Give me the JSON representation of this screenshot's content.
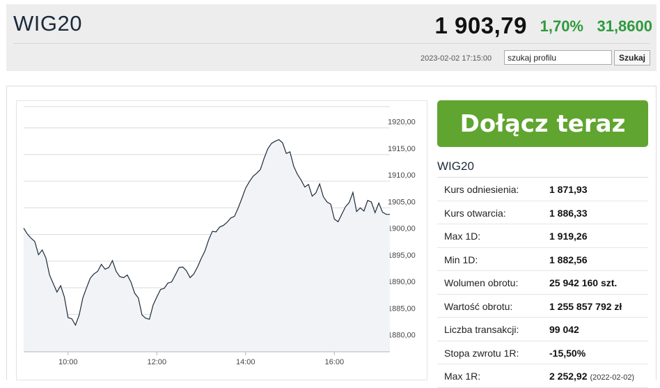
{
  "header": {
    "title": "WIG20",
    "price": "1 903,79",
    "change_pct": "1,70%",
    "change_abs": "31,8600",
    "timestamp": "2023-02-02 17:15:00",
    "search_value": "szukaj profilu",
    "search_button": "Szukaj"
  },
  "colors": {
    "accent_green": "#2e9a3e",
    "cta_green": "#5fa52f",
    "line": "#1b2a3a",
    "fill": "#f1f3f6"
  },
  "cta": {
    "label": "Dołącz teraz"
  },
  "sidebar": {
    "title": "WIG20",
    "rows": [
      {
        "label": "Kurs odniesienia:",
        "value": "1 871,93"
      },
      {
        "label": "Kurs otwarcia:",
        "value": "1 886,33"
      },
      {
        "label": "Max 1D:",
        "value": "1 919,26"
      },
      {
        "label": "Min 1D:",
        "value": "1 882,56"
      },
      {
        "label": "Wolumen obrotu:",
        "value": "25 942 160 szt."
      },
      {
        "label": "Wartość obrotu:",
        "value": "1 255 857 792 zł"
      },
      {
        "label": "Liczba transakcji:",
        "value": "99 042"
      },
      {
        "label": "Stopa zwrotu 1R:",
        "value": "-15,50%"
      },
      {
        "label": "Max 1R:",
        "value": "2 252,92",
        "note": "(2022-02-02)"
      }
    ]
  },
  "chart_data": {
    "type": "area",
    "y_ticks": [
      "1880,00",
      "1885,00",
      "1890,00",
      "1895,00",
      "1900,00",
      "1905,00",
      "1910,00",
      "1915,00",
      "1920,00"
    ],
    "x_ticks": [
      "10:00",
      "12:00",
      "14:00",
      "16:00"
    ],
    "ylim": [
      1878,
      1924
    ],
    "xlim": [
      "09:00",
      "17:15"
    ],
    "grid": true,
    "series": [
      {
        "x": [
          "09:00",
          "09:05",
          "09:10",
          "09:15",
          "09:20",
          "09:25",
          "09:30",
          "09:35",
          "09:40",
          "09:45",
          "09:50",
          "09:55",
          "10:00",
          "10:05",
          "10:10",
          "10:15",
          "10:20",
          "10:25",
          "10:30",
          "10:35",
          "10:40",
          "10:45",
          "10:50",
          "10:55",
          "11:00",
          "11:05",
          "11:10",
          "11:15",
          "11:20",
          "11:25",
          "11:30",
          "11:35",
          "11:40",
          "11:45",
          "11:50",
          "11:55",
          "12:00",
          "12:05",
          "12:10",
          "12:15",
          "12:20",
          "12:25",
          "12:30",
          "12:35",
          "12:40",
          "12:45",
          "12:50",
          "12:55",
          "13:00",
          "13:05",
          "13:10",
          "13:15",
          "13:20",
          "13:25",
          "13:30",
          "13:35",
          "13:40",
          "13:45",
          "13:50",
          "13:55",
          "14:00",
          "14:05",
          "14:10",
          "14:15",
          "14:20",
          "14:25",
          "14:30",
          "14:35",
          "14:40",
          "14:45",
          "14:50",
          "14:55",
          "15:00",
          "15:05",
          "15:10",
          "15:15",
          "15:20",
          "15:25",
          "15:30",
          "15:35",
          "15:40",
          "15:45",
          "15:50",
          "15:55",
          "16:00",
          "16:05",
          "16:10",
          "16:15",
          "16:20",
          "16:25",
          "16:30",
          "16:35",
          "16:40",
          "16:45",
          "16:50",
          "16:55",
          "17:00",
          "17:05",
          "17:10",
          "17:15"
        ],
        "values": [
          1901.2,
          1900.1,
          1899.3,
          1898.7,
          1896.2,
          1897.1,
          1895.6,
          1892.4,
          1890.8,
          1889.2,
          1890.4,
          1888.3,
          1884.4,
          1884.2,
          1883.0,
          1884.9,
          1888.1,
          1890.0,
          1891.8,
          1892.6,
          1893.1,
          1894.4,
          1893.5,
          1893.8,
          1895.1,
          1893.1,
          1892.1,
          1891.9,
          1892.4,
          1891.1,
          1889.0,
          1888.1,
          1884.9,
          1884.3,
          1884.1,
          1886.8,
          1888.3,
          1889.7,
          1889.9,
          1890.9,
          1891.1,
          1892.4,
          1893.8,
          1893.9,
          1893.2,
          1891.9,
          1892.6,
          1893.9,
          1895.5,
          1896.9,
          1899.0,
          1900.6,
          1900.5,
          1901.4,
          1901.7,
          1902.3,
          1903.1,
          1903.4,
          1905.0,
          1906.8,
          1908.7,
          1909.9,
          1910.9,
          1911.5,
          1912.2,
          1914.3,
          1916.1,
          1917.1,
          1917.5,
          1917.8,
          1917.2,
          1915.2,
          1915.5,
          1912.8,
          1911.3,
          1910.2,
          1908.9,
          1909.4,
          1907.2,
          1907.8,
          1909.5,
          1907.1,
          1906.1,
          1905.7,
          1902.9,
          1902.4,
          1903.8,
          1905.2,
          1906.0,
          1907.9,
          1904.3,
          1905.0,
          1904.4,
          1906.4,
          1906.1,
          1904.1,
          1905.9,
          1904.2,
          1903.8,
          1903.79
        ]
      }
    ]
  }
}
